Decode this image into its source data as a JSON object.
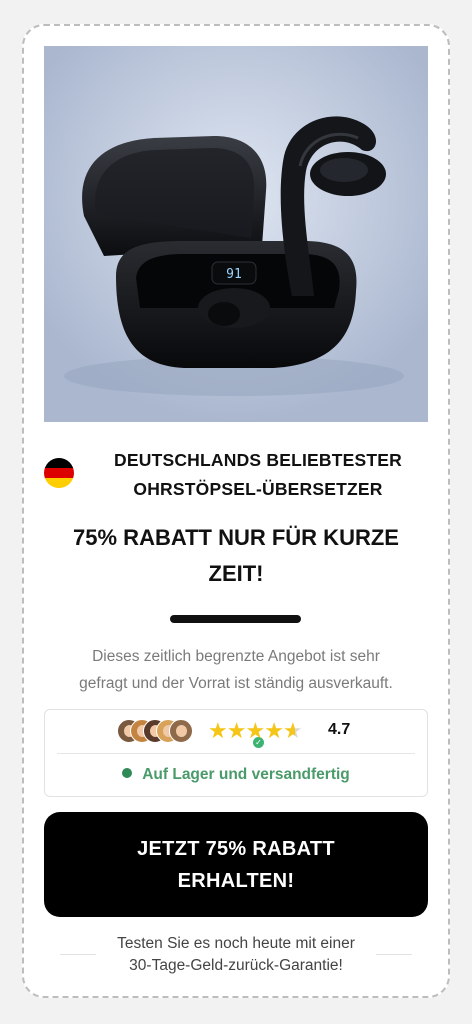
{
  "product": {
    "headline_line1": "DEUTSCHLANDS BELIEBTESTER",
    "headline_line2": "OHRSTÖPSEL-ÜBERSETZER",
    "flag_icon": "germany-flag-icon",
    "flag_colors": [
      "#000000",
      "#dd0000",
      "#ffce00"
    ],
    "image_display_text": "91"
  },
  "promo": {
    "line1": "75% RABATT NUR FÜR KURZE",
    "line2": "ZEIT!"
  },
  "description": {
    "line1": "Dieses zeitlich begrenzte Angebot ist sehr",
    "line2": "gefragt und der Vorrat ist ständig ausverkauft."
  },
  "rating": {
    "value": "4.7",
    "stars_filled": 4.7,
    "stars_total": 5,
    "avatar_count": 5,
    "star_color": "#f5c518"
  },
  "stock": {
    "label": "Auf Lager und versandfertig",
    "color": "#4a9a6a"
  },
  "cta": {
    "line1": "JETZT 75% RABATT",
    "line2": "ERHALTEN!"
  },
  "guarantee": {
    "line1": "Testen Sie es noch heute mit einer",
    "line2": "30-Tage-Geld-zurück-Garantie!"
  }
}
